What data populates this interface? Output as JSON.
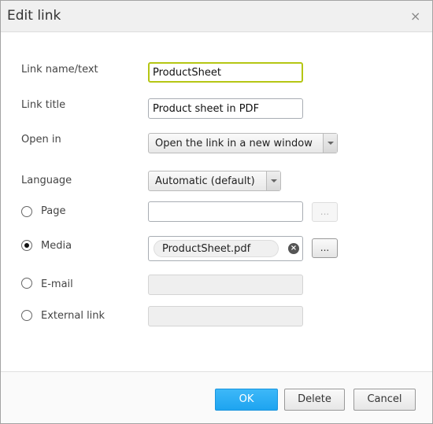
{
  "dialog": {
    "title": "Edit link",
    "close_label": "×"
  },
  "fields": {
    "link_name": {
      "label": "Link name/text",
      "value": "ProductSheet"
    },
    "link_title": {
      "label": "Link title",
      "value": "Product sheet in PDF"
    },
    "open_in": {
      "label": "Open in",
      "value": "Open the link in a new window"
    },
    "language": {
      "label": "Language",
      "value": "Automatic (default)"
    },
    "page": {
      "label": "Page",
      "value": "",
      "browse": "...",
      "selected": false
    },
    "media": {
      "label": "Media",
      "value": "ProductSheet.pdf",
      "browse": "...",
      "selected": true,
      "clear": "×"
    },
    "email": {
      "label": "E-mail",
      "value": "",
      "selected": false
    },
    "external": {
      "label": "External link",
      "value": "",
      "selected": false
    }
  },
  "footer": {
    "ok": "OK",
    "delete": "Delete",
    "cancel": "Cancel"
  },
  "colors": {
    "focus": "#b5c614",
    "primary": "#2aaef5"
  }
}
